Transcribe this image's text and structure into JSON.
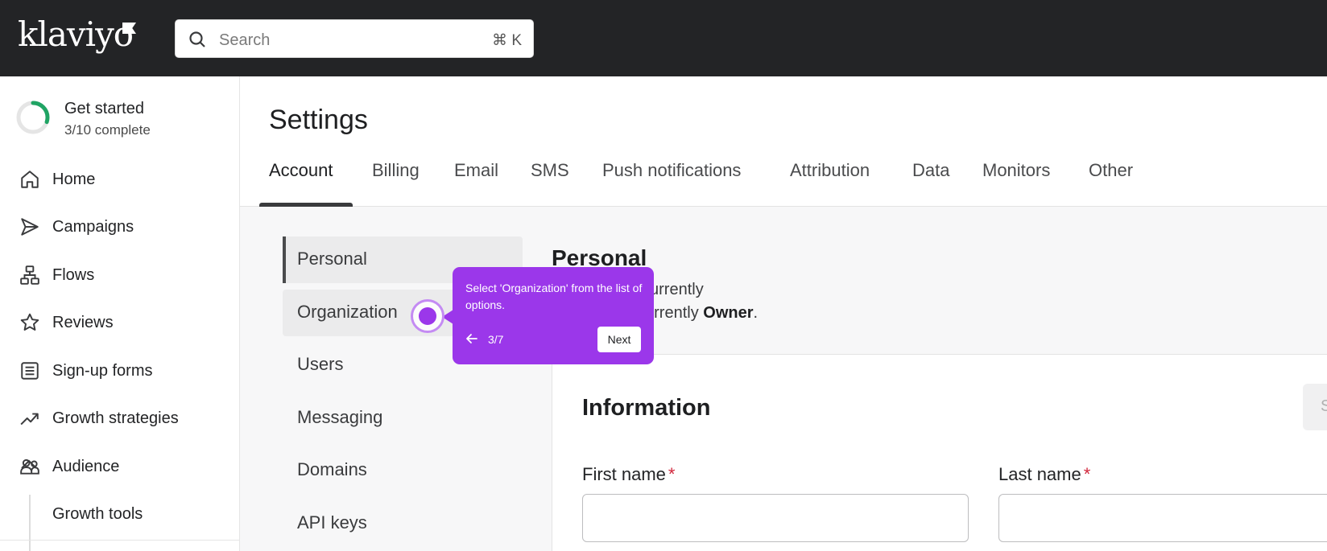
{
  "brand": {
    "name": "klaviyo"
  },
  "search": {
    "placeholder": "Search",
    "shortcut": "⌘ K"
  },
  "get_started": {
    "title": "Get started",
    "progress_text": "3/10 complete",
    "progress": 0.3
  },
  "sidebar": {
    "items": [
      {
        "label": "Home",
        "icon": "home-icon"
      },
      {
        "label": "Campaigns",
        "icon": "send-icon"
      },
      {
        "label": "Flows",
        "icon": "flows-icon"
      },
      {
        "label": "Reviews",
        "icon": "star-icon"
      },
      {
        "label": "Sign-up forms",
        "icon": "form-icon"
      },
      {
        "label": "Growth strategies",
        "icon": "trending-up-icon"
      },
      {
        "label": "Audience",
        "icon": "users-icon",
        "expanded": true
      }
    ],
    "subitems": [
      {
        "label": "Growth tools"
      }
    ]
  },
  "page": {
    "title": "Settings"
  },
  "tabs": [
    "Account",
    "Billing",
    "Email",
    "SMS",
    "Push notifications",
    "Attribution",
    "Data",
    "Monitors",
    "Other"
  ],
  "subnav": [
    "Personal",
    "Organization",
    "Users",
    "Messaging",
    "Domains",
    "API keys"
  ],
  "personal": {
    "title": "Personal",
    "line1": "currently",
    "line2_prefix": "urrently",
    "line2_role": "Owner",
    "line2_suffix": "."
  },
  "information": {
    "title": "Information",
    "button_partial": "S",
    "first_name_label": "First name",
    "last_name_label": "Last name",
    "required_mark": "*"
  },
  "walkthrough": {
    "text": "Select 'Organization' from the list of options.",
    "step": "3/7",
    "next_label": "Next",
    "color": "#9b37ea"
  }
}
